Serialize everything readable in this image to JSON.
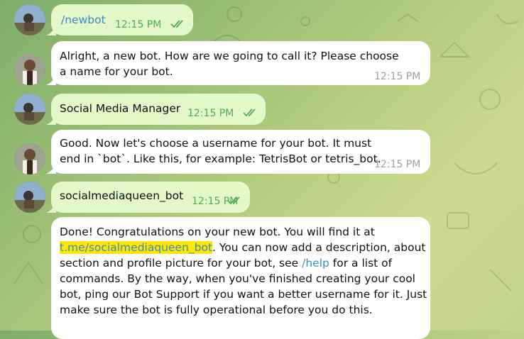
{
  "messages": [
    {
      "text": "/newbot",
      "time": "12:15 PM",
      "direction": "outgoing",
      "status": "read"
    },
    {
      "text": "Alright, a new bot. How are we going to call it? Please choose a name for your bot.",
      "time": "12:15 PM",
      "direction": "incoming"
    },
    {
      "text": "Social Media Manager",
      "time": "12:15 PM",
      "direction": "outgoing",
      "status": "read"
    },
    {
      "text": "Good. Now let's choose a username for your bot. It must end in `bot`. Like this, for example: TetrisBot or tetris_bot.",
      "time": "12:15 PM",
      "direction": "incoming"
    },
    {
      "text": "socialmediaqueen_bot",
      "time": "12:15 PM",
      "direction": "outgoing",
      "status": "read"
    },
    {
      "direction": "incoming",
      "parts": {
        "p1": "Done! Congratulations on your new bot. You will find it at",
        "link": "t.me/socialmediaqueen_bot",
        "p2": ". You can now add a description, about",
        "p3": "section and profile picture for your bot, see ",
        "help_link": "/help",
        "p4": " for a list of",
        "p5": "commands. By the way, when you've finished creating your cool",
        "p6": "bot, ping our Bot Support if you want a better username for it. Just",
        "p7": "make sure the bot is fully operational before you do this."
      }
    }
  ],
  "colors": {
    "outgoing_bubble": "#e3f7c8",
    "incoming_bubble": "#ffffff",
    "link": "#3a8cc9",
    "highlight": "#ffe600",
    "read_ticks": "#4fae4e"
  }
}
